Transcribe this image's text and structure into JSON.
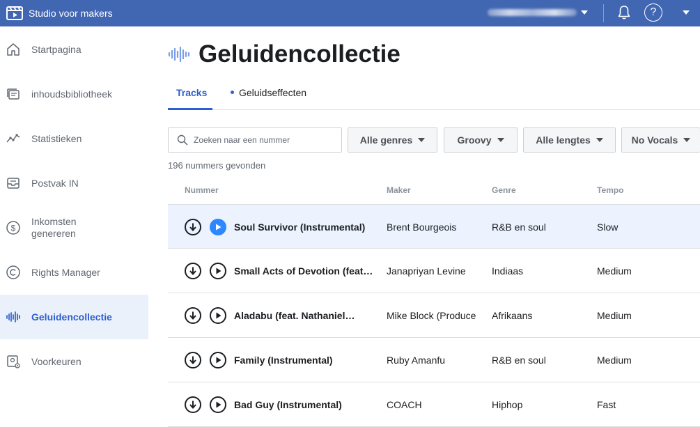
{
  "app": {
    "title": "Studio voor makers",
    "logo_icon": "clapperboard-play-icon"
  },
  "header": {
    "help_label": "?",
    "notifications_icon": "bell-icon",
    "more_icon": "chevron-down-icon"
  },
  "sidebar": {
    "items": [
      {
        "label": "Startpagina",
        "icon": "home-icon"
      },
      {
        "label": "inhoudsbibliotheek",
        "icon": "library-icon"
      },
      {
        "label": "Statistieken",
        "icon": "stats-icon"
      },
      {
        "label": "Postvak IN",
        "icon": "inbox-icon"
      },
      {
        "label": "Inkomsten genereren",
        "icon": "dollar-icon"
      },
      {
        "label": "Rights Manager",
        "icon": "copyright-icon"
      },
      {
        "label": "Geluidencollectie",
        "icon": "soundwave-icon",
        "active": true
      },
      {
        "label": "Voorkeuren",
        "icon": "settings-icon"
      }
    ]
  },
  "main": {
    "title": "Geluidencollectie",
    "tabs": [
      {
        "label": "Tracks",
        "active": true
      },
      {
        "label": "Geluidseffecten"
      }
    ],
    "search": {
      "placeholder": "Zoeken naar een nummer"
    },
    "filters": [
      {
        "label": "Alle genres"
      },
      {
        "label": "Groovy"
      },
      {
        "label": "Alle lengtes"
      },
      {
        "label": "No Vocals"
      }
    ],
    "result_count": "196 nummers gevonden",
    "columns": {
      "track": "Nummer",
      "maker": "Maker",
      "genre": "Genre",
      "tempo": "Tempo"
    },
    "rows": [
      {
        "name": "Soul Survivor (Instrumental)",
        "maker": "Brent Bourgeois",
        "genre": "R&B en soul",
        "tempo": "Slow",
        "playing": true
      },
      {
        "name": "Small Acts of Devotion (feat. …",
        "maker": "Janapriyan Levine",
        "genre": "Indiaas",
        "tempo": "Medium"
      },
      {
        "name": "Aladabu (feat. Nathaniel…",
        "maker": "Mike Block (Produce",
        "genre": "Afrikaans",
        "tempo": "Medium"
      },
      {
        "name": "Family (Instrumental)",
        "maker": "Ruby Amanfu",
        "genre": "R&B en soul",
        "tempo": "Medium"
      },
      {
        "name": "Bad Guy (Instrumental)",
        "maker": "COACH",
        "genre": "Hiphop",
        "tempo": "Fast"
      }
    ]
  },
  "colors": {
    "topbar": "#4267b2",
    "accent": "#2d5fcf",
    "play_active": "#2d88ff",
    "selected_row": "#ecf3ff"
  }
}
